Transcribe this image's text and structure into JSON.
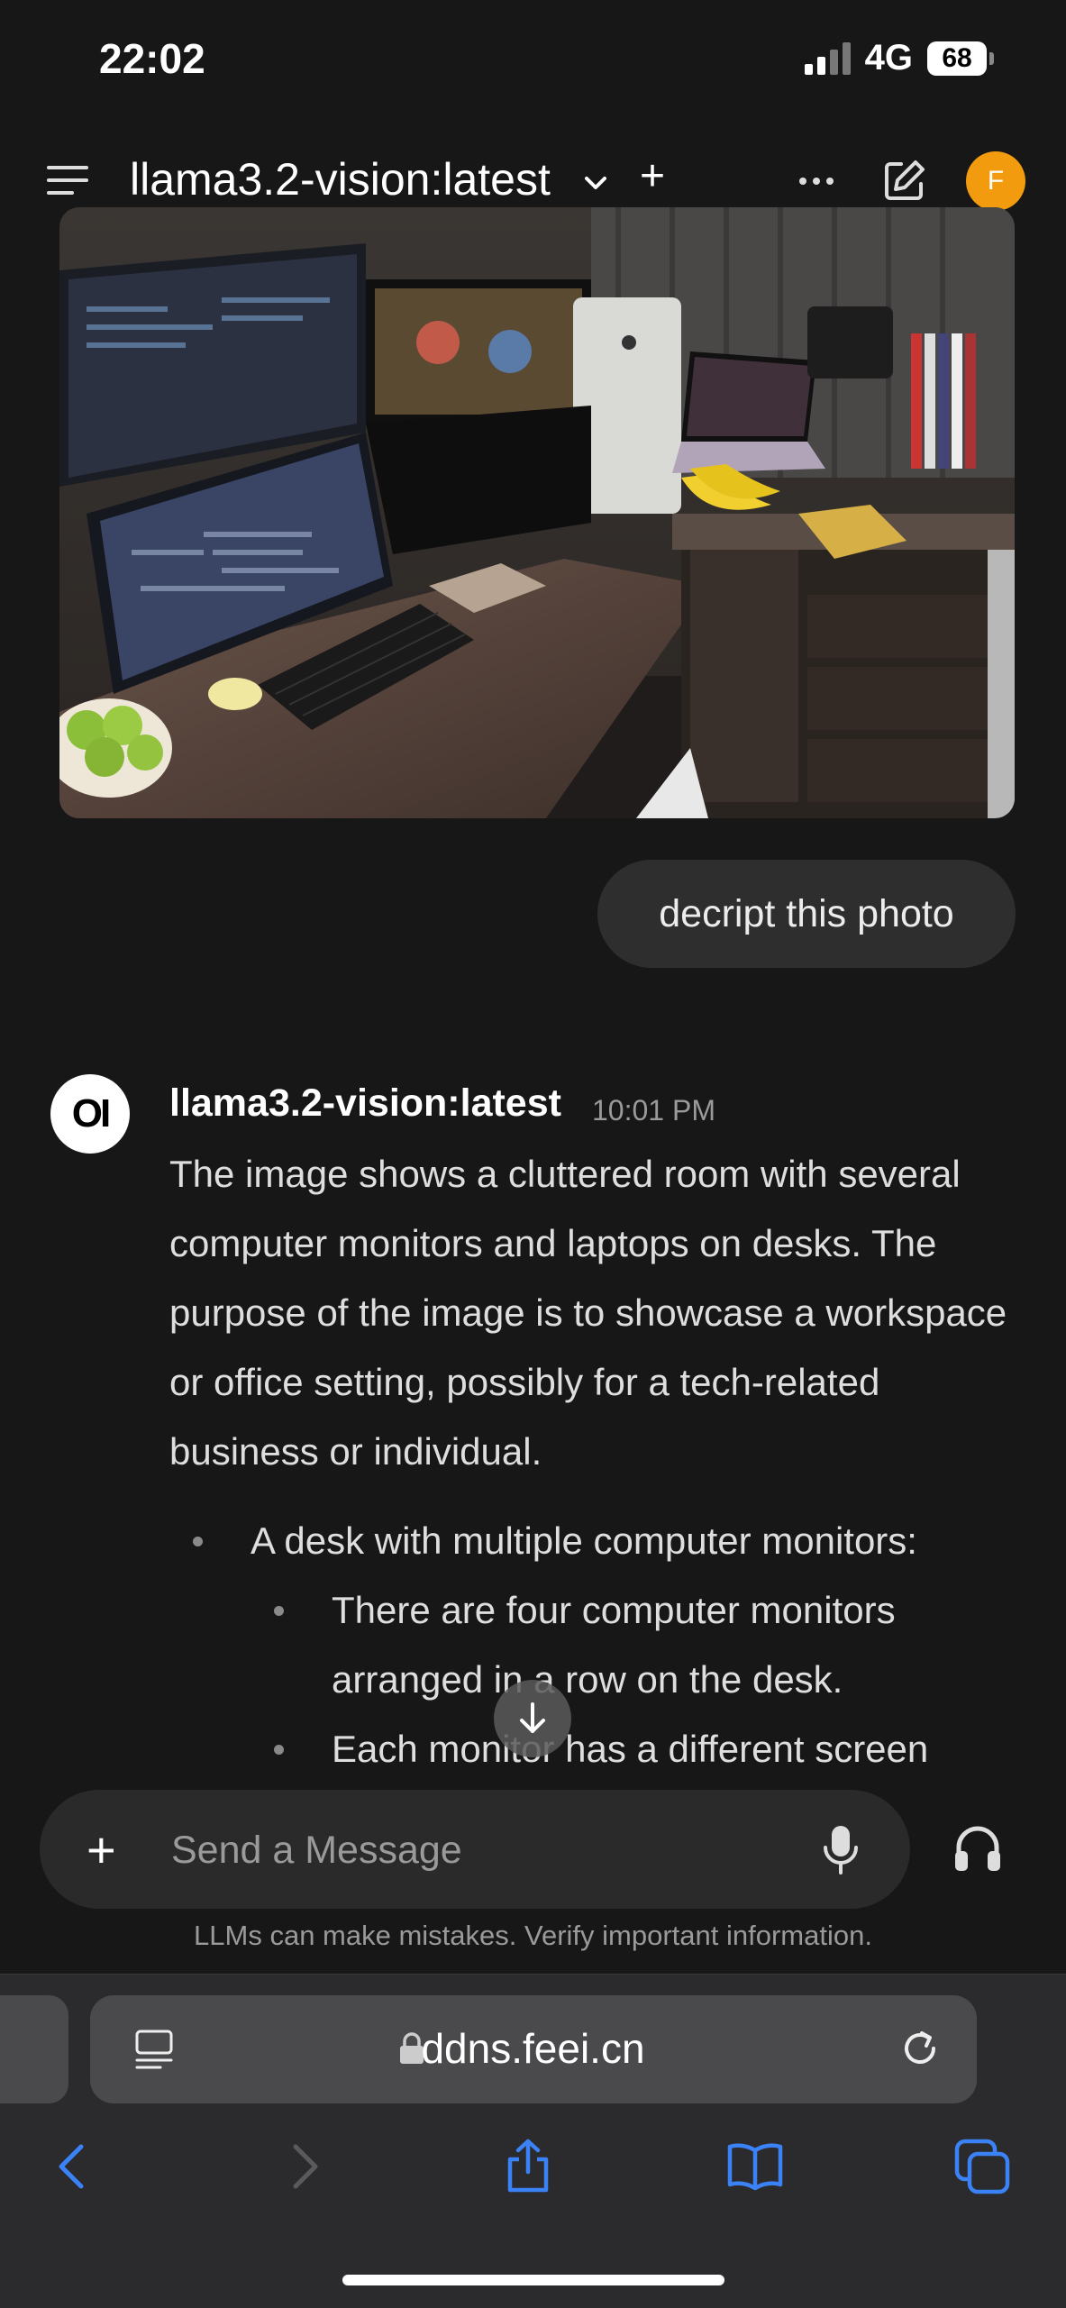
{
  "status": {
    "time": "22:02",
    "network": "4G",
    "battery": "68"
  },
  "header": {
    "model": "llama3.2-vision:latest",
    "avatar_initial": "F"
  },
  "conversation": {
    "user_message": "decript this photo",
    "assistant": {
      "name": "llama3.2-vision:latest",
      "time": "10:01 PM",
      "logo": "OI",
      "paragraph": "The image shows a cluttered room with several computer monitors and laptops on desks. The purpose of the image is to showcase a workspace or office setting, possibly for a tech-related business or individual.",
      "bullet": "A desk with multiple computer monitors:",
      "sub_bullets": [
        "There are four computer monitors arranged in a row on the desk.",
        "Each monitor has a different screen"
      ]
    }
  },
  "composer": {
    "placeholder": "Send a Message"
  },
  "disclaimer": "LLMs can make mistakes. Verify important information.",
  "browser": {
    "url": "ddns.feei.cn"
  },
  "colors": {
    "background": "#171717",
    "avatar": "#f29b0e",
    "safari_accent": "#3b82f6"
  }
}
